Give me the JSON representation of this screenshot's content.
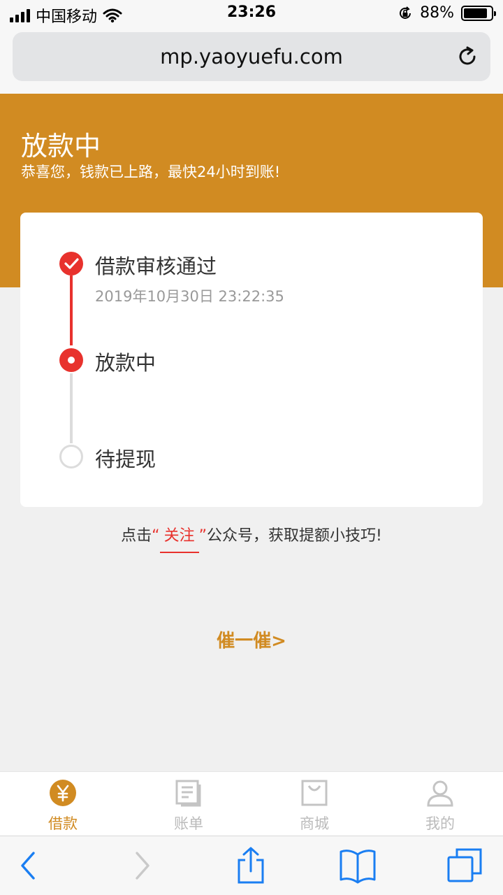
{
  "status_bar": {
    "carrier": "中国移动",
    "time": "23:26",
    "battery": "88%",
    "battery_level": 0.88
  },
  "browser": {
    "url": "mp.yaoyuefu.com",
    "reload_icon": "reload-icon"
  },
  "header": {
    "title": "放款中",
    "subtitle": "恭喜您，钱款已上路，最快24小时到账!"
  },
  "steps": [
    {
      "label": "借款审核通过",
      "time": "2019年10月30日 23:22:35",
      "state": "done"
    },
    {
      "label": "放款中",
      "state": "active"
    },
    {
      "label": "待提现",
      "state": "pending"
    }
  ],
  "follow": {
    "prefix": "点击",
    "open_quote": "“",
    "link": "关注",
    "close_quote": "”",
    "suffix": "公众号，获取提额小技巧!"
  },
  "urge_button": "催一催>",
  "tabs": [
    {
      "label": "借款",
      "icon": "yen-circle-icon",
      "active": true
    },
    {
      "label": "账单",
      "icon": "bill-icon",
      "active": false
    },
    {
      "label": "商城",
      "icon": "shopping-bag-icon",
      "active": false
    },
    {
      "label": "我的",
      "icon": "user-icon",
      "active": false
    }
  ],
  "colors": {
    "brand": "#d18b22",
    "accent_red": "#e8322d",
    "inactive_gray": "#bbbbbb",
    "ios_blue": "#1a7ef2"
  }
}
